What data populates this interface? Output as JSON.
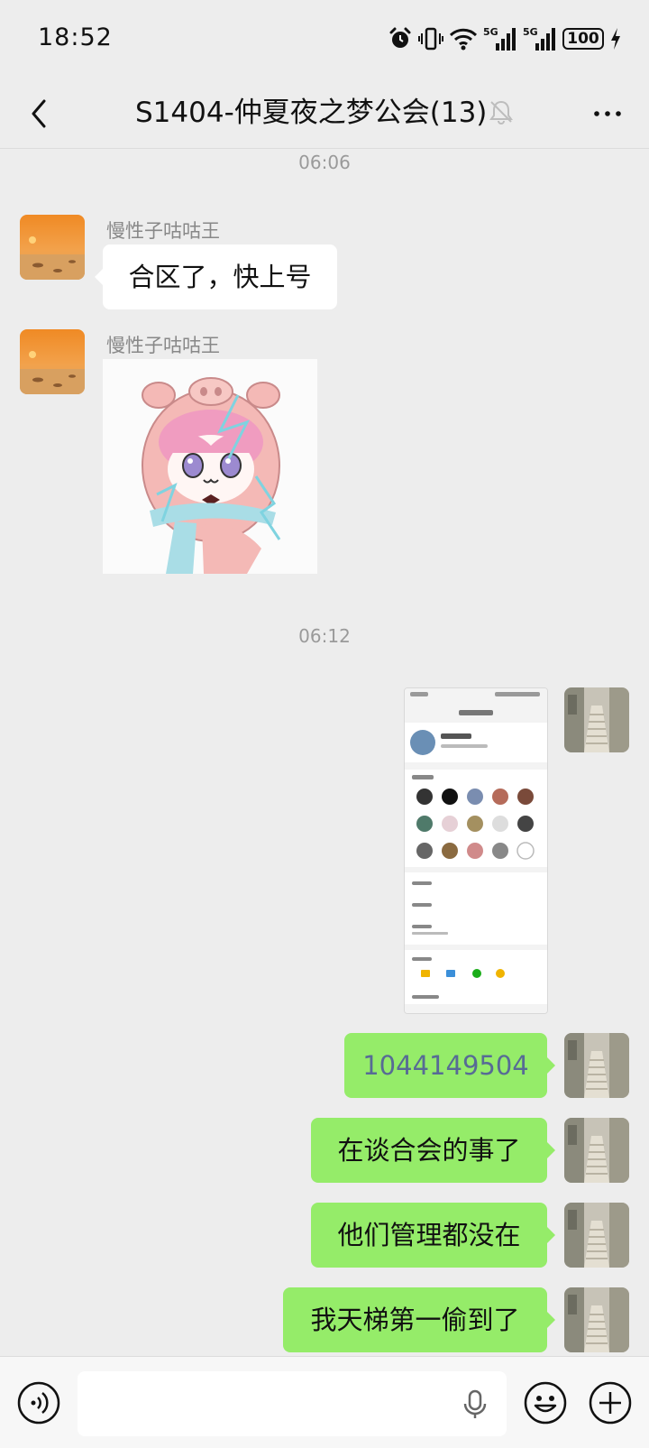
{
  "status_bar": {
    "time": "18:52",
    "network_1": "5G",
    "network_2": "5G",
    "battery": "100",
    "icons": [
      "alarm-icon",
      "vibrate-icon",
      "wifi-icon",
      "signal-icon",
      "signal-icon",
      "battery-icon",
      "charging-icon"
    ]
  },
  "header": {
    "title": "S1404-仲夏夜之梦公会(13)",
    "back_icon": "back-arrow-icon",
    "mute_icon": "muted-bell-icon",
    "more_icon": "more-dots-icon"
  },
  "chat": {
    "timestamps": [
      "06:06",
      "06:12"
    ],
    "messages": [
      {
        "side": "left",
        "sender": "慢性子咕咕王",
        "type": "text",
        "text": "合区了，快上号"
      },
      {
        "side": "left",
        "sender": "慢性子咕咕王",
        "type": "sticker"
      },
      {
        "side": "right",
        "type": "image"
      },
      {
        "side": "right",
        "type": "text",
        "text": "1044149504"
      },
      {
        "side": "right",
        "type": "text",
        "text": "在谈合会的事了"
      },
      {
        "side": "right",
        "type": "text",
        "text": "他们管理都没在"
      },
      {
        "side": "right",
        "type": "text",
        "text": "我天梯第一偷到了"
      }
    ]
  },
  "input_bar": {
    "voice_icon": "voice-mode-icon",
    "mic_icon": "microphone-icon",
    "emoji_icon": "emoji-icon",
    "plus_icon": "plus-icon",
    "draft": ""
  },
  "colors": {
    "chat_background": "#ededed",
    "outgoing_bubble": "#95ec69",
    "incoming_bubble": "#ffffff",
    "link_text": "#576b95"
  }
}
